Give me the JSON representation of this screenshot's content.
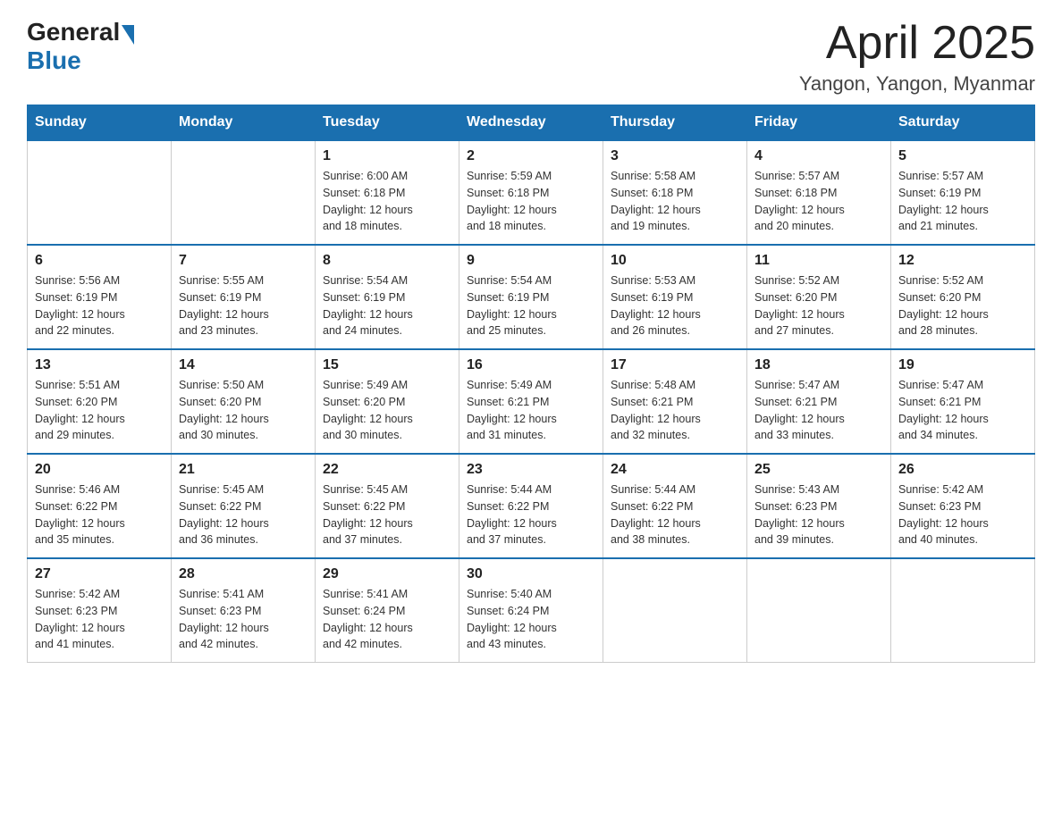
{
  "logo": {
    "general": "General",
    "blue": "Blue"
  },
  "title": "April 2025",
  "subtitle": "Yangon, Yangon, Myanmar",
  "days_of_week": [
    "Sunday",
    "Monday",
    "Tuesday",
    "Wednesday",
    "Thursday",
    "Friday",
    "Saturday"
  ],
  "weeks": [
    [
      {
        "day": "",
        "info": ""
      },
      {
        "day": "",
        "info": ""
      },
      {
        "day": "1",
        "info": "Sunrise: 6:00 AM\nSunset: 6:18 PM\nDaylight: 12 hours\nand 18 minutes."
      },
      {
        "day": "2",
        "info": "Sunrise: 5:59 AM\nSunset: 6:18 PM\nDaylight: 12 hours\nand 18 minutes."
      },
      {
        "day": "3",
        "info": "Sunrise: 5:58 AM\nSunset: 6:18 PM\nDaylight: 12 hours\nand 19 minutes."
      },
      {
        "day": "4",
        "info": "Sunrise: 5:57 AM\nSunset: 6:18 PM\nDaylight: 12 hours\nand 20 minutes."
      },
      {
        "day": "5",
        "info": "Sunrise: 5:57 AM\nSunset: 6:19 PM\nDaylight: 12 hours\nand 21 minutes."
      }
    ],
    [
      {
        "day": "6",
        "info": "Sunrise: 5:56 AM\nSunset: 6:19 PM\nDaylight: 12 hours\nand 22 minutes."
      },
      {
        "day": "7",
        "info": "Sunrise: 5:55 AM\nSunset: 6:19 PM\nDaylight: 12 hours\nand 23 minutes."
      },
      {
        "day": "8",
        "info": "Sunrise: 5:54 AM\nSunset: 6:19 PM\nDaylight: 12 hours\nand 24 minutes."
      },
      {
        "day": "9",
        "info": "Sunrise: 5:54 AM\nSunset: 6:19 PM\nDaylight: 12 hours\nand 25 minutes."
      },
      {
        "day": "10",
        "info": "Sunrise: 5:53 AM\nSunset: 6:19 PM\nDaylight: 12 hours\nand 26 minutes."
      },
      {
        "day": "11",
        "info": "Sunrise: 5:52 AM\nSunset: 6:20 PM\nDaylight: 12 hours\nand 27 minutes."
      },
      {
        "day": "12",
        "info": "Sunrise: 5:52 AM\nSunset: 6:20 PM\nDaylight: 12 hours\nand 28 minutes."
      }
    ],
    [
      {
        "day": "13",
        "info": "Sunrise: 5:51 AM\nSunset: 6:20 PM\nDaylight: 12 hours\nand 29 minutes."
      },
      {
        "day": "14",
        "info": "Sunrise: 5:50 AM\nSunset: 6:20 PM\nDaylight: 12 hours\nand 30 minutes."
      },
      {
        "day": "15",
        "info": "Sunrise: 5:49 AM\nSunset: 6:20 PM\nDaylight: 12 hours\nand 30 minutes."
      },
      {
        "day": "16",
        "info": "Sunrise: 5:49 AM\nSunset: 6:21 PM\nDaylight: 12 hours\nand 31 minutes."
      },
      {
        "day": "17",
        "info": "Sunrise: 5:48 AM\nSunset: 6:21 PM\nDaylight: 12 hours\nand 32 minutes."
      },
      {
        "day": "18",
        "info": "Sunrise: 5:47 AM\nSunset: 6:21 PM\nDaylight: 12 hours\nand 33 minutes."
      },
      {
        "day": "19",
        "info": "Sunrise: 5:47 AM\nSunset: 6:21 PM\nDaylight: 12 hours\nand 34 minutes."
      }
    ],
    [
      {
        "day": "20",
        "info": "Sunrise: 5:46 AM\nSunset: 6:22 PM\nDaylight: 12 hours\nand 35 minutes."
      },
      {
        "day": "21",
        "info": "Sunrise: 5:45 AM\nSunset: 6:22 PM\nDaylight: 12 hours\nand 36 minutes."
      },
      {
        "day": "22",
        "info": "Sunrise: 5:45 AM\nSunset: 6:22 PM\nDaylight: 12 hours\nand 37 minutes."
      },
      {
        "day": "23",
        "info": "Sunrise: 5:44 AM\nSunset: 6:22 PM\nDaylight: 12 hours\nand 37 minutes."
      },
      {
        "day": "24",
        "info": "Sunrise: 5:44 AM\nSunset: 6:22 PM\nDaylight: 12 hours\nand 38 minutes."
      },
      {
        "day": "25",
        "info": "Sunrise: 5:43 AM\nSunset: 6:23 PM\nDaylight: 12 hours\nand 39 minutes."
      },
      {
        "day": "26",
        "info": "Sunrise: 5:42 AM\nSunset: 6:23 PM\nDaylight: 12 hours\nand 40 minutes."
      }
    ],
    [
      {
        "day": "27",
        "info": "Sunrise: 5:42 AM\nSunset: 6:23 PM\nDaylight: 12 hours\nand 41 minutes."
      },
      {
        "day": "28",
        "info": "Sunrise: 5:41 AM\nSunset: 6:23 PM\nDaylight: 12 hours\nand 42 minutes."
      },
      {
        "day": "29",
        "info": "Sunrise: 5:41 AM\nSunset: 6:24 PM\nDaylight: 12 hours\nand 42 minutes."
      },
      {
        "day": "30",
        "info": "Sunrise: 5:40 AM\nSunset: 6:24 PM\nDaylight: 12 hours\nand 43 minutes."
      },
      {
        "day": "",
        "info": ""
      },
      {
        "day": "",
        "info": ""
      },
      {
        "day": "",
        "info": ""
      }
    ]
  ]
}
